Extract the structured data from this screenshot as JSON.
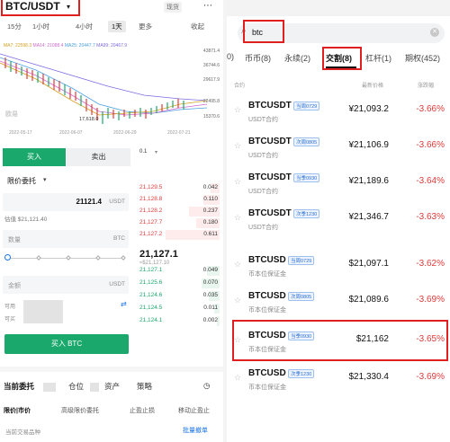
{
  "left": {
    "pair": "BTC/USDT",
    "spot_label": "现货",
    "timeframes": [
      "15分",
      "1小时",
      "4小时",
      "1天",
      "更多",
      "收起"
    ],
    "active_timeframe": "1天",
    "ma_labels": [
      {
        "text": "MA7: 22598.3",
        "color": "#d4a020"
      },
      {
        "text": "MA14: 21088.4",
        "color": "#d06ad0"
      },
      {
        "text": "MA25: 20447.7",
        "color": "#4aa0e0"
      },
      {
        "text": "MA99: 20467.9",
        "color": "#7c6ae0"
      }
    ],
    "chart": {
      "y_ticks": [
        "43871.4",
        "36744.6",
        "29617.9",
        "22495.8",
        "15370.6"
      ],
      "x_ticks": [
        "2022-05-17",
        "2022-06-07",
        "2022-06-29",
        "2022-07-21"
      ],
      "low_label": "17,618.0",
      "high_label": "22495.8",
      "watermark": "欧易"
    },
    "buy_tab": "买入",
    "sell_tab": "卖出",
    "order_type": "限价委托",
    "price_value": "21121.4",
    "price_unit": "USDT",
    "valuation": "估值 $21,121.40",
    "amount_placeholder": "数量",
    "amount_unit": "BTC",
    "total_placeholder": "金额",
    "total_unit": "USDT",
    "available_label": "可用",
    "can_buy_label": "可买",
    "buy_button": "买入 BTC",
    "orderbook": {
      "precision": "0.1",
      "asks": [
        {
          "price": "21,129.5",
          "qty": "0.042"
        },
        {
          "price": "21,128.8",
          "qty": "0.110"
        },
        {
          "price": "21,128.2",
          "qty": "0.237"
        },
        {
          "price": "21,127.7",
          "qty": "0.180"
        },
        {
          "price": "21,127.2",
          "qty": "0.611"
        }
      ],
      "mid_price": "21,127.1",
      "mid_sub": "≈$21,127.10",
      "bids": [
        {
          "price": "21,127.1",
          "qty": "0.049"
        },
        {
          "price": "21,125.6",
          "qty": "0.070"
        },
        {
          "price": "21,124.6",
          "qty": "0.035"
        },
        {
          "price": "21,124.5",
          "qty": "0.011"
        },
        {
          "price": "21,124.1",
          "qty": "0.002"
        }
      ]
    },
    "bottom_tabs": [
      "当前委托",
      "仓位",
      "资产",
      "策略"
    ],
    "sub_tabs": [
      "限价|市价",
      "高级限价委托",
      "止盈止损",
      "移动止盈止"
    ],
    "note": "当前交易品种",
    "batch_cancel": "批量撤单"
  },
  "right": {
    "search_text": "btc",
    "categories": [
      {
        "label": "0)",
        "active": false
      },
      {
        "label": "币币(8)",
        "active": false
      },
      {
        "label": "永续(2)",
        "active": false
      },
      {
        "label": "交割(8)",
        "active": true
      },
      {
        "label": "杠杆(1)",
        "active": false
      },
      {
        "label": "期权(452)",
        "active": false
      }
    ],
    "col_headers": {
      "name": "合约",
      "price": "最新价格",
      "change": "涨跌幅"
    },
    "futures": [
      {
        "symbol": "BTCUSDT",
        "tag": "当周0729",
        "sub": "USDT合约",
        "price": "¥21,093.2",
        "change": "-3.66%"
      },
      {
        "symbol": "BTCUSDT",
        "tag": "次周0805",
        "sub": "USDT合约",
        "price": "¥21,106.9",
        "change": "-3.66%"
      },
      {
        "symbol": "BTCUSDT",
        "tag": "当季0930",
        "sub": "USDT合约",
        "price": "¥21,189.6",
        "change": "-3.64%"
      },
      {
        "symbol": "BTCUSDT",
        "tag": "次季1230",
        "sub": "USDT合约",
        "price": "¥21,346.7",
        "change": "-3.63%"
      },
      {
        "symbol": "BTCUSD",
        "tag": "当周0729",
        "sub": "币本位保证金",
        "price": "$21,097.1",
        "change": "-3.62%"
      },
      {
        "symbol": "BTCUSD",
        "tag": "次周0805",
        "sub": "币本位保证金",
        "price": "$21,089.6",
        "change": "-3.69%"
      },
      {
        "symbol": "BTCUSD",
        "tag": "当季0930",
        "sub": "币本位保证金",
        "price": "$21,162",
        "change": "-3.65%"
      },
      {
        "symbol": "BTCUSD",
        "tag": "次季1230",
        "sub": "币本位保证金",
        "price": "$21,330.4",
        "change": "-3.69%"
      }
    ]
  }
}
